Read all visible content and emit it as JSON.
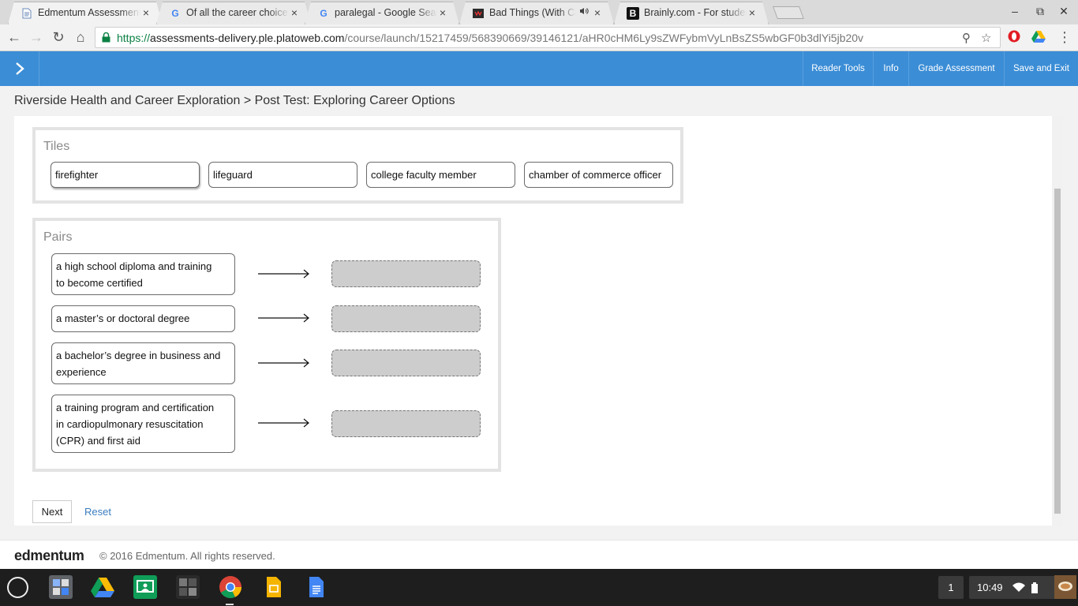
{
  "browser": {
    "tabs": [
      {
        "title": "Edmentum Assessments",
        "favicon": "doc-icon",
        "active": true,
        "close": "×"
      },
      {
        "title": "Of all the career choices",
        "favicon": "google-icon",
        "active": false,
        "close": "×"
      },
      {
        "title": "paralegal - Google Search",
        "favicon": "google-icon",
        "active": false,
        "close": "×"
      },
      {
        "title": "Bad Things (With Camila",
        "favicon": "video-icon",
        "active": false,
        "close": "×",
        "mute": "speaker-icon"
      },
      {
        "title": "Brainly.com - For students",
        "favicon": "brainly-icon",
        "active": false,
        "close": "×"
      }
    ],
    "url": {
      "scheme": "https://",
      "host": "assessments-delivery.ple.platoweb.com",
      "path": "/course/launch/15217459/568390669/39146121/aHR0cHM6Ly9sZWFybmVyLnBsZS5wbGF0b3dlYi5jb20v"
    },
    "glyphs": {
      "back": "←",
      "forward": "→",
      "reload": "↻",
      "home": "⌂",
      "zoom": "⚲",
      "star": "☆",
      "menu": "⋮",
      "minimize": "–",
      "maximize": "⧉",
      "close": "✕",
      "tab_favicon_g": "G",
      "tab_favicon_b": "B"
    }
  },
  "app": {
    "menu_toggle": ">",
    "header_buttons": [
      "Reader Tools",
      "Info",
      "Grade Assessment",
      "Save and Exit"
    ],
    "breadcrumb": "Riverside Health and Career Exploration > Post Test: Exploring Career Options",
    "tiles_title": "Tiles",
    "tiles": [
      "firefighter",
      "lifeguard",
      "college faculty member",
      "chamber of commerce officer"
    ],
    "pairs_title": "Pairs",
    "pairs": [
      {
        "label_lines": [
          "a high school diploma and training",
          "to become certified"
        ]
      },
      {
        "label_lines": [
          "a master’s or doctoral degree"
        ]
      },
      {
        "label_lines": [
          "a bachelor’s degree in business and",
          "experience"
        ]
      },
      {
        "label_lines": [
          "a training program and certification",
          "in cardiopulmonary resuscitation",
          "(CPR) and first aid"
        ]
      }
    ],
    "next_label": "Next",
    "reset_label": "Reset",
    "footer_logo": "edmentum",
    "footer_copyright": "© 2016 Edmentum. All rights reserved."
  },
  "shelf": {
    "apps": [
      "calculator-icon",
      "drive-icon",
      "classroom-icon",
      "window-icon",
      "chrome-icon",
      "slides-icon",
      "docs-icon"
    ],
    "notification_count": "1",
    "time": "10:49"
  },
  "colors": {
    "header_blue": "#3b8dd6",
    "drop_gray": "#cdcdcd",
    "link_blue": "#3b7dbf"
  }
}
